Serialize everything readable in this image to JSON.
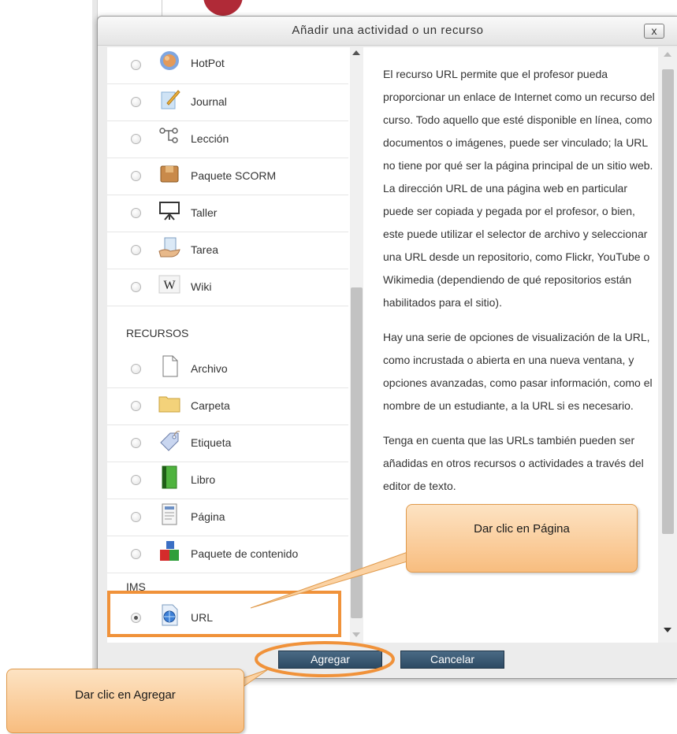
{
  "dialog": {
    "title": "Añadir una actividad o un recurso",
    "close_label": "x"
  },
  "activities": [
    {
      "label": "HotPot",
      "icon": "hotpot-icon"
    },
    {
      "label": "Journal",
      "icon": "journal-icon"
    },
    {
      "label": "Lección",
      "icon": "lesson-icon"
    },
    {
      "label": "Paquete SCORM",
      "icon": "scorm-package-icon"
    },
    {
      "label": "Taller",
      "icon": "workshop-icon"
    },
    {
      "label": "Tarea",
      "icon": "assignment-icon"
    },
    {
      "label": "Wiki",
      "icon": "wiki-icon"
    }
  ],
  "sections": {
    "resources": "RECURSOS",
    "ims": "IMS"
  },
  "resources": [
    {
      "label": "Archivo",
      "icon": "file-icon"
    },
    {
      "label": "Carpeta",
      "icon": "folder-icon"
    },
    {
      "label": "Etiqueta",
      "icon": "label-icon"
    },
    {
      "label": "Libro",
      "icon": "book-icon"
    },
    {
      "label": "Página",
      "icon": "page-icon"
    },
    {
      "label": "Paquete de contenido",
      "icon": "content-package-icon"
    }
  ],
  "ims_items": [
    {
      "label": "URL",
      "icon": "url-icon",
      "selected": true
    }
  ],
  "description": {
    "paragraph1": "El recurso URL permite que el profesor pueda proporcionar un enlace de Internet como un recurso del curso. Todo aquello que esté disponible en línea, como documentos o imágenes, puede ser vinculado; la URL no tiene por qué ser la página principal de un sitio web. La dirección URL de una página web en particular puede ser copiada y pegada por el profesor, o bien, este puede utilizar el selector de archivo y seleccionar una URL desde un repositorio, como Flickr, YouTube o Wikimedia (dependiendo de qué repositorios están habilitados para el sitio).",
    "paragraph2": "Hay una serie de opciones de visualización de la URL, como incrustada o abierta en una nueva ventana, y opciones avanzadas, como pasar información, como el nombre de un estudiante, a la URL si es necesario.",
    "paragraph3": "Tenga en cuenta que las URLs también pueden ser añadidas en otros recursos o actividades a través del editor de texto."
  },
  "buttons": {
    "add": "Agregar",
    "cancel": "Cancelar"
  },
  "annotations": {
    "callout_page": "Dar clic en Página",
    "callout_add": "Dar clic en Agregar"
  },
  "colors": {
    "highlight": "#f0923a",
    "button_bg": "#35536d",
    "callout_fill": "#fbd2a3"
  }
}
